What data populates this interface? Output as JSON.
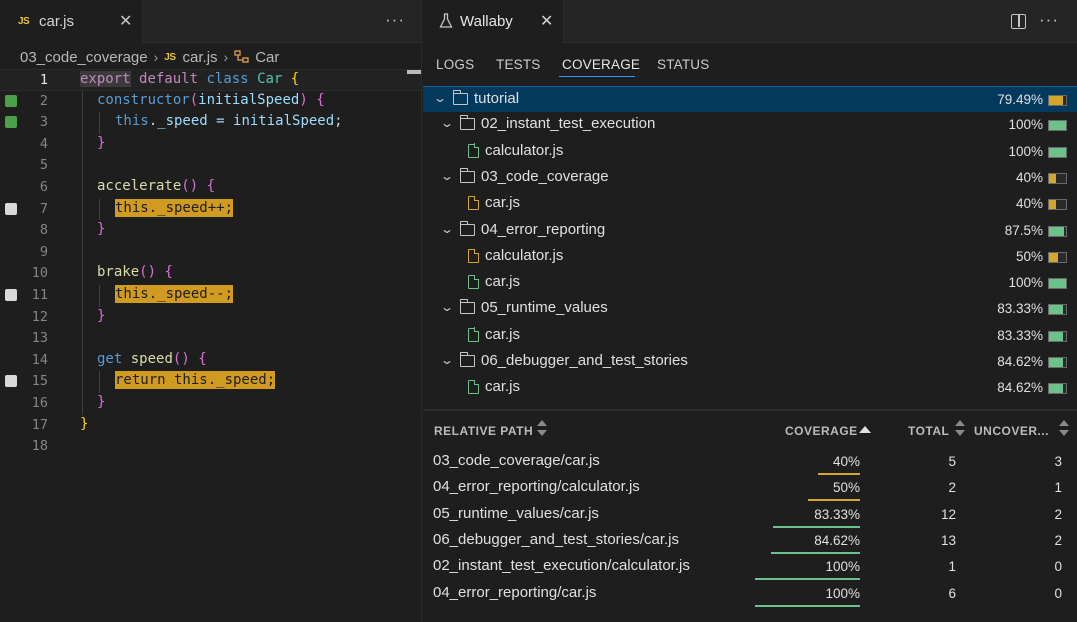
{
  "editor": {
    "tab": {
      "lang_badge": "JS",
      "label": "car.js",
      "close": "✕"
    },
    "more": "···",
    "breadcrumb": {
      "folder": "03_code_coverage",
      "file_badge": "JS",
      "file": "car.js",
      "symbol": "Car"
    },
    "lines": [
      {
        "n": "1"
      },
      {
        "n": "2"
      },
      {
        "n": "3"
      },
      {
        "n": "4"
      },
      {
        "n": "5"
      },
      {
        "n": "6"
      },
      {
        "n": "7"
      },
      {
        "n": "8"
      },
      {
        "n": "9"
      },
      {
        "n": "10"
      },
      {
        "n": "11"
      },
      {
        "n": "12"
      },
      {
        "n": "13"
      },
      {
        "n": "14"
      },
      {
        "n": "15"
      },
      {
        "n": "16"
      },
      {
        "n": "17"
      },
      {
        "n": "18"
      }
    ],
    "code": {
      "l1": {
        "export": "export",
        "default": "default",
        "class": "class",
        "name": "Car",
        "brace": "{"
      },
      "l2": {
        "ctor": "constructor",
        "p1": "(",
        "param": "initialSpeed",
        "p2": ")",
        "brace": "{"
      },
      "l3": {
        "this": "this",
        "rest": "._speed = ",
        "param": "initialSpeed",
        "semi": ";"
      },
      "l4": {
        "brace": "}"
      },
      "l6": {
        "fn": "accelerate",
        "parens": "()",
        "brace": "{"
      },
      "l7": {
        "text": "this._speed++;"
      },
      "l8": {
        "brace": "}"
      },
      "l10": {
        "fn": "brake",
        "parens": "()",
        "brace": "{"
      },
      "l11": {
        "text": "this._speed--;"
      },
      "l12": {
        "brace": "}"
      },
      "l14": {
        "get": "get",
        "fn": "speed",
        "parens": "()",
        "brace": "{"
      },
      "l15": {
        "text": "return this._speed;"
      },
      "l16": {
        "brace": "}"
      },
      "l17": {
        "brace": "}"
      }
    }
  },
  "wallaby": {
    "tab": {
      "label": "Wallaby",
      "close": "✕"
    },
    "more": "···",
    "subtabs": [
      "LOGS",
      "TESTS",
      "COVERAGE",
      "STATUS"
    ],
    "tree": [
      {
        "name": "tutorial",
        "pct": "79.49%",
        "value": 79.49
      },
      {
        "name": "02_instant_test_execution",
        "pct": "100%",
        "value": 100
      },
      {
        "name": "calculator.js",
        "pct": "100%",
        "value": 100
      },
      {
        "name": "03_code_coverage",
        "pct": "40%",
        "value": 40
      },
      {
        "name": "car.js",
        "pct": "40%",
        "value": 40
      },
      {
        "name": "04_error_reporting",
        "pct": "87.5%",
        "value": 87.5
      },
      {
        "name": "calculator.js",
        "pct": "50%",
        "value": 50
      },
      {
        "name": "car.js",
        "pct": "100%",
        "value": 100
      },
      {
        "name": "05_runtime_values",
        "pct": "83.33%",
        "value": 83.33
      },
      {
        "name": "car.js",
        "pct": "83.33%",
        "value": 83.33
      },
      {
        "name": "06_debugger_and_test_stories",
        "pct": "84.62%",
        "value": 84.62
      },
      {
        "name": "car.js",
        "pct": "84.62%",
        "value": 84.62
      }
    ],
    "table": {
      "headers": {
        "path": "RELATIVE PATH",
        "coverage": "COVERAGE",
        "total": "TOTAL",
        "uncovered": "UNCOVER..."
      },
      "rows": [
        {
          "path": "03_code_coverage/car.js",
          "coverage": "40%",
          "value": 40,
          "total": "5",
          "uncovered": "3"
        },
        {
          "path": "04_error_reporting/calculator.js",
          "coverage": "50%",
          "value": 50,
          "total": "2",
          "uncovered": "1"
        },
        {
          "path": "05_runtime_values/car.js",
          "coverage": "83.33%",
          "value": 83.33,
          "total": "12",
          "uncovered": "2"
        },
        {
          "path": "06_debugger_and_test_stories/car.js",
          "coverage": "84.62%",
          "value": 84.62,
          "total": "13",
          "uncovered": "2"
        },
        {
          "path": "02_instant_test_execution/calculator.js",
          "coverage": "100%",
          "value": 100,
          "total": "1",
          "uncovered": "0"
        },
        {
          "path": "04_error_reporting/car.js",
          "coverage": "100%",
          "value": 100,
          "total": "6",
          "uncovered": "0"
        }
      ]
    }
  },
  "colors": {
    "covered": "#6bc28a",
    "partial": "#d4a72c",
    "accent": "#3794ff"
  }
}
